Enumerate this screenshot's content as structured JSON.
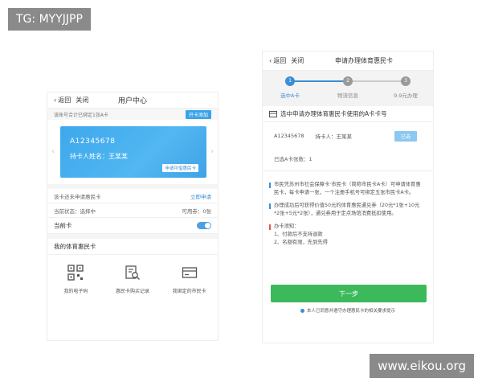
{
  "watermarks": {
    "top": "TG: MYYJJPP",
    "bottom": "www.eikou.org"
  },
  "left": {
    "nav": {
      "back": "返回",
      "close": "关闭",
      "title": "用户中心"
    },
    "bind_hint": "该账号合计已绑定1张A卡",
    "add_button": "开卡添加",
    "card": {
      "number": "A12345678",
      "holder": "持卡人姓名：王某某",
      "apply_label": "申请可借惠民卡"
    },
    "rows": [
      {
        "label": "该卡还未申请惠民卡",
        "value": "立即申请",
        "link": true
      },
      {
        "label": "当前状态：选择中",
        "value": "可用券：0张",
        "link": false
      }
    ],
    "current_card": {
      "label": "当前卡",
      "toggle_on": true
    },
    "section_title": "我的体育惠民卡",
    "grid": [
      {
        "label": "我的电子码",
        "icon": "qrcode-icon"
      },
      {
        "label": "惠民卡购买记录",
        "icon": "record-search-icon"
      },
      {
        "label": "我绑定的市民卡",
        "icon": "card-icon"
      }
    ]
  },
  "right": {
    "nav": {
      "back": "返回",
      "close": "关闭",
      "title": "申请办理体育惠民卡"
    },
    "steps": [
      {
        "num": "1",
        "label": "选中A卡",
        "active": true
      },
      {
        "num": "2",
        "label": "物流信息",
        "active": false
      },
      {
        "num": "3",
        "label": "9.9元办理",
        "active": false
      }
    ],
    "heading": "选中申请办理体育惠民卡使用的A卡卡号",
    "selected": {
      "number": "A12345678",
      "holder": "持卡人：王某某",
      "button": "已选"
    },
    "selected_count": "已选A卡张数：1",
    "para1": "市民凭苏州市社会保障卡·市民卡（简称市民卡A卡）可申请体育惠民卡，每卡申请一张，一个注册手机号可绑定五张市民卡A卡。",
    "para2": "办理成功后可获得价值50元的体育惠民通兑券（20元*1张+10元*2张+5元*2张），通兑券用于定点场馆消费抵扣使用。",
    "notice_title": "办卡须知：",
    "notice": [
      "1、付款后不支持退款",
      "2、名额有限，先到先得"
    ],
    "next_button": "下一步",
    "agree_text": "本人已同意并遵守办理惠民卡的相关要求提示"
  },
  "colors": {
    "accent": "#3a8fd6",
    "green": "#3cb95a",
    "card": "#45adee"
  }
}
